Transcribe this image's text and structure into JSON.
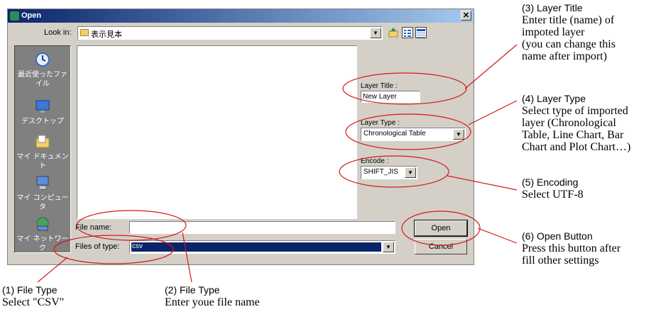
{
  "dialog": {
    "title": "Open",
    "look_in_label": "Look in:",
    "look_in_value": "表示見本",
    "places": [
      {
        "label": "最近使ったファイル",
        "icon": "recent-files-icon"
      },
      {
        "label": "デスクトップ",
        "icon": "desktop-icon"
      },
      {
        "label": "マイ ドキュメント",
        "icon": "my-documents-icon"
      },
      {
        "label": "マイ コンピュータ",
        "icon": "my-computer-icon"
      },
      {
        "label": "マイ ネットワーク",
        "icon": "my-network-icon"
      }
    ],
    "layer_title_label": "Layer Title :",
    "layer_title_value": "New Layer",
    "layer_type_label": "Layer Type :",
    "layer_type_value": "Chronological Table",
    "encode_label": "Encode :",
    "encode_value": "SHIFT_JIS",
    "file_name_label": "File name:",
    "file_name_value": "",
    "files_of_type_label": "Files of type:",
    "files_of_type_value": "csv",
    "open_button": "Open",
    "cancel_button": "Cancel"
  },
  "annotations": {
    "layer_title": {
      "heading": "(3) Layer Title",
      "body": [
        "Enter title (name) of",
        "impoted layer",
        "(you can change this",
        "name after import)"
      ]
    },
    "layer_type": {
      "heading": "(4) Layer Type",
      "body": [
        "Select type of imported",
        "layer (Chronological",
        "Table, Line Chart, Bar",
        "Chart and Plot Chart…)"
      ]
    },
    "encoding": {
      "heading": "(5) Encoding",
      "body": [
        "Select UTF-8"
      ]
    },
    "open_button": {
      "heading": "(6) Open Button",
      "body": [
        "Press this button after",
        "fill other settings"
      ]
    },
    "file_type": {
      "heading": "(1) File Type",
      "body": [
        "Select \"CSV\""
      ]
    },
    "file_name": {
      "heading": "(2) File Type",
      "body": [
        "Enter youe file name"
      ]
    }
  },
  "colors": {
    "titlebar_start": "#0a246a",
    "selection": "#0a246a",
    "annotation_red": "#d11a1a"
  }
}
